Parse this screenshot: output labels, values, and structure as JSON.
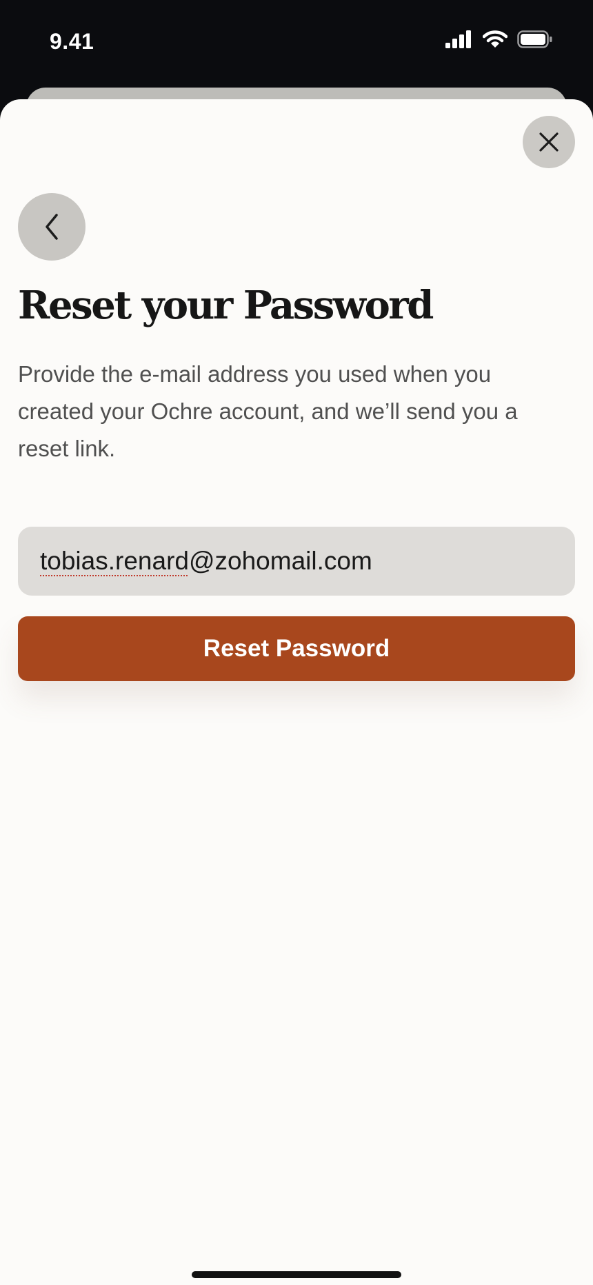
{
  "status_bar": {
    "time": "9.41",
    "icons": [
      "signal-icon",
      "wifi-icon",
      "battery-icon"
    ]
  },
  "sheet": {
    "title": "Reset your Password",
    "description": "Provide the e-mail address you used when you created your Ochre account, and we’ll send you a reset link.",
    "email_field": {
      "value_user": "tobias.renard",
      "value_domain": "@zohomail.com"
    },
    "reset_button_label": "Reset Password",
    "icons": {
      "close": "close-icon",
      "back": "chevron-left-icon"
    }
  },
  "colors": {
    "accent": "#a8471d",
    "sheet_background": "#fcfbf9",
    "field_background": "#dedcd9",
    "icon_button_background": "#cbc9c5"
  }
}
